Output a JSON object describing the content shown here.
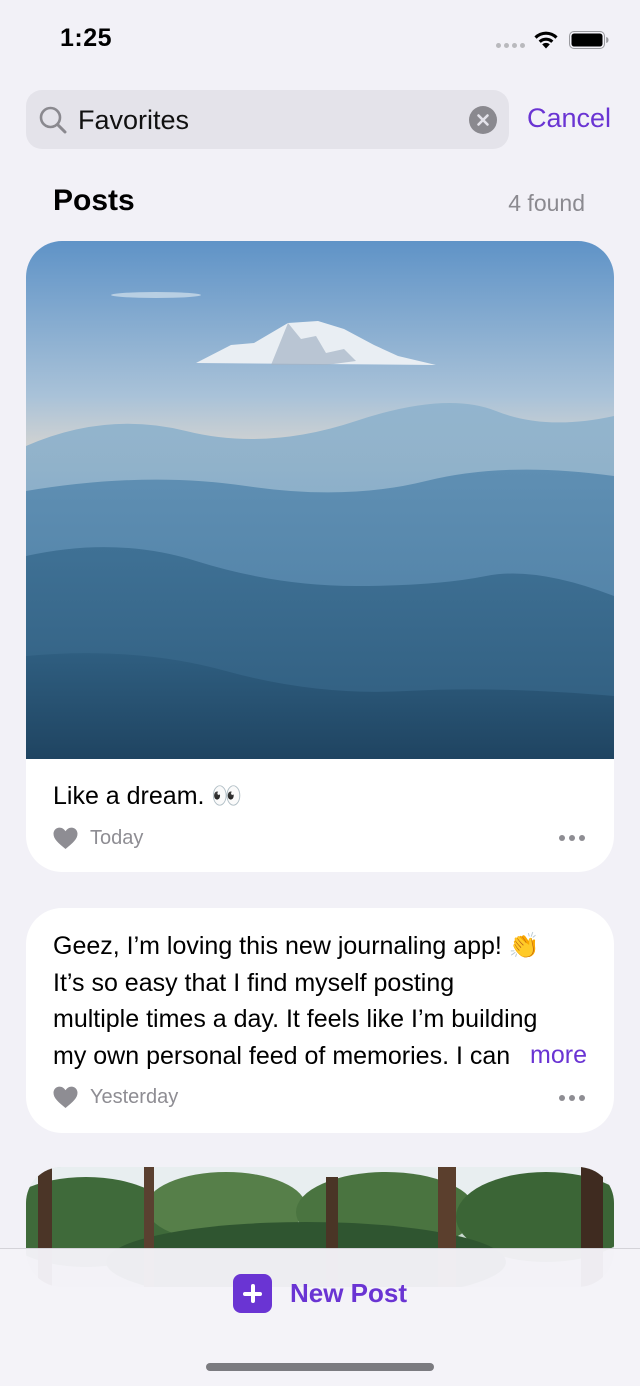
{
  "status": {
    "time": "1:25"
  },
  "search": {
    "query": "Favorites",
    "cancel_label": "Cancel"
  },
  "section": {
    "title": "Posts",
    "count": "4 found"
  },
  "posts": [
    {
      "caption": "Like a dream. 👀",
      "date": "Today",
      "image": "mountain-landscape"
    },
    {
      "lines": [
        "Geez, I’m loving this new journaling app! 👏",
        "It’s so easy that I find myself posting",
        "multiple times a day. It feels like I’m building",
        "my own personal feed of memories. I can"
      ],
      "more_label": "more",
      "date": "Yesterday"
    },
    {
      "image": "forest-trees"
    }
  ],
  "bottom": {
    "new_post_label": "New Post"
  },
  "colors": {
    "accent": "#6a34d3",
    "background": "#f2f1f7",
    "secondary_text": "#8e8d93"
  },
  "icons": [
    "search-icon",
    "clear-icon",
    "heart-icon",
    "more-dots-icon",
    "plus-icon",
    "wifi-icon",
    "battery-icon"
  ]
}
